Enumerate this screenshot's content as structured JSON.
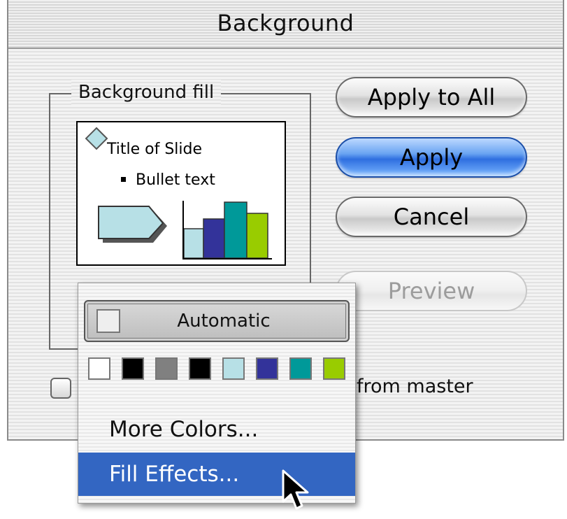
{
  "dialog": {
    "title": "Background"
  },
  "group": {
    "label": "Background fill"
  },
  "preview": {
    "title_text": "Title of Slide",
    "bullet_text": "Bullet text",
    "colors": {
      "light": "#b7e0e6",
      "navy": "#33339a",
      "teal": "#009999",
      "green": "#99cc00"
    }
  },
  "buttons": {
    "apply_all": "Apply to All",
    "apply": "Apply",
    "cancel": "Cancel",
    "preview": "Preview"
  },
  "checkbox": {
    "label_visible": "from master",
    "checked": false
  },
  "menu": {
    "automatic": "Automatic",
    "swatches": [
      "#ffffff",
      "#000000",
      "#808080",
      "#000000",
      "#b7e0e6",
      "#33339a",
      "#009999",
      "#99cc00"
    ],
    "more_colors": "More Colors...",
    "fill_effects": "Fill Effects...",
    "highlight_color": "#3366c2"
  }
}
